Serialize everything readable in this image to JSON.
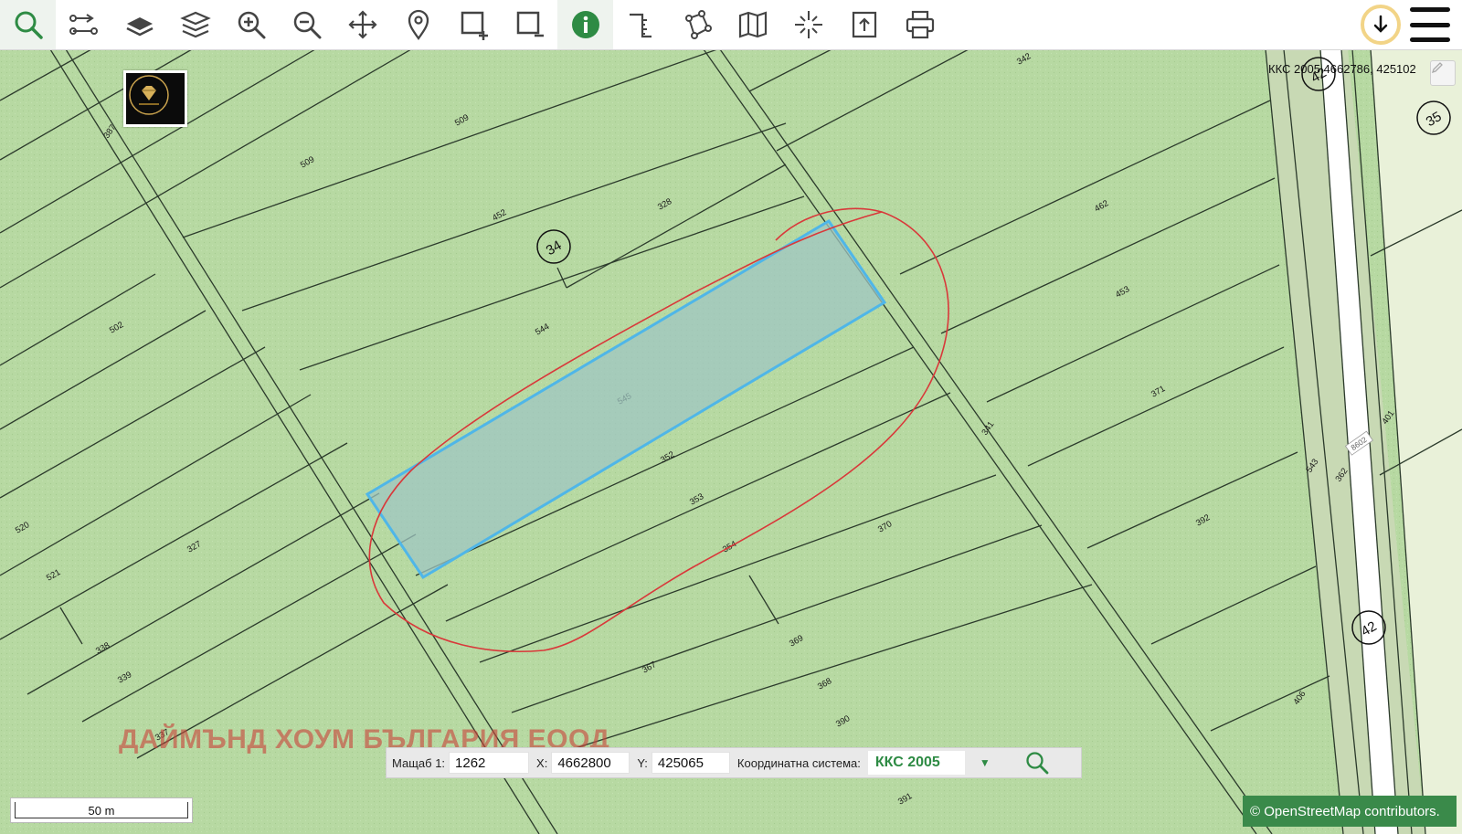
{
  "toolbar": {
    "tools": [
      {
        "name": "search-tool",
        "icon": "magnifier-icon"
      },
      {
        "name": "route-tool",
        "icon": "route-icon"
      },
      {
        "name": "base-layer-tool",
        "icon": "layer-single-icon"
      },
      {
        "name": "layers-tool",
        "icon": "layers-icon"
      },
      {
        "name": "zoom-in-tool",
        "icon": "zoom-in-icon"
      },
      {
        "name": "zoom-out-tool",
        "icon": "zoom-out-icon"
      },
      {
        "name": "pan-tool",
        "icon": "move-arrows-icon"
      },
      {
        "name": "pin-tool",
        "icon": "map-pin-icon"
      },
      {
        "name": "add-area-tool",
        "icon": "square-plus-icon"
      },
      {
        "name": "remove-area-tool",
        "icon": "square-minus-icon"
      },
      {
        "name": "info-tool",
        "icon": "info-icon"
      },
      {
        "name": "measure-tool",
        "icon": "ruler-icon"
      },
      {
        "name": "polygon-tool",
        "icon": "polygon-nodes-icon"
      },
      {
        "name": "map-tool",
        "icon": "folded-map-icon"
      },
      {
        "name": "crosshair-tool",
        "icon": "crosshair-icon"
      },
      {
        "name": "export-tool",
        "icon": "export-icon"
      },
      {
        "name": "print-tool",
        "icon": "printer-icon"
      }
    ],
    "active_tool": "info-tool",
    "accent_color": "#2e8b44"
  },
  "map": {
    "coordinate_readout": "ККС 2005 4662786, 425102",
    "watermark": "ДАЙМЪНД ХОУМ БЪЛГАРИЯ ЕООД",
    "scale_label": "50 m",
    "attribution": "© OpenStreetMap contributors.",
    "parcel_color": "#b7d9a2",
    "highlight_color": "#4fb6e8",
    "annotation_color": "#d9383a",
    "parcel_labels": [
      "342",
      "509",
      "509",
      "387",
      "452",
      "328",
      "462",
      "453",
      "502",
      "544",
      "545",
      "352",
      "353",
      "354",
      "341",
      "371",
      "370",
      "520",
      "521",
      "327",
      "338",
      "339",
      "337",
      "367",
      "369",
      "368",
      "390",
      "391",
      "392",
      "406",
      "401",
      "362",
      "543",
      "8602"
    ],
    "circle_labels": [
      "42",
      "35",
      "34",
      "42"
    ]
  },
  "coord_panel": {
    "scale_label": "Мащаб 1:",
    "scale_value": "1262",
    "x_label": "X:",
    "x_value": "4662800",
    "y_label": "Y:",
    "y_value": "425065",
    "crs_label": "Координатна система:",
    "crs_value": "ККС 2005"
  }
}
